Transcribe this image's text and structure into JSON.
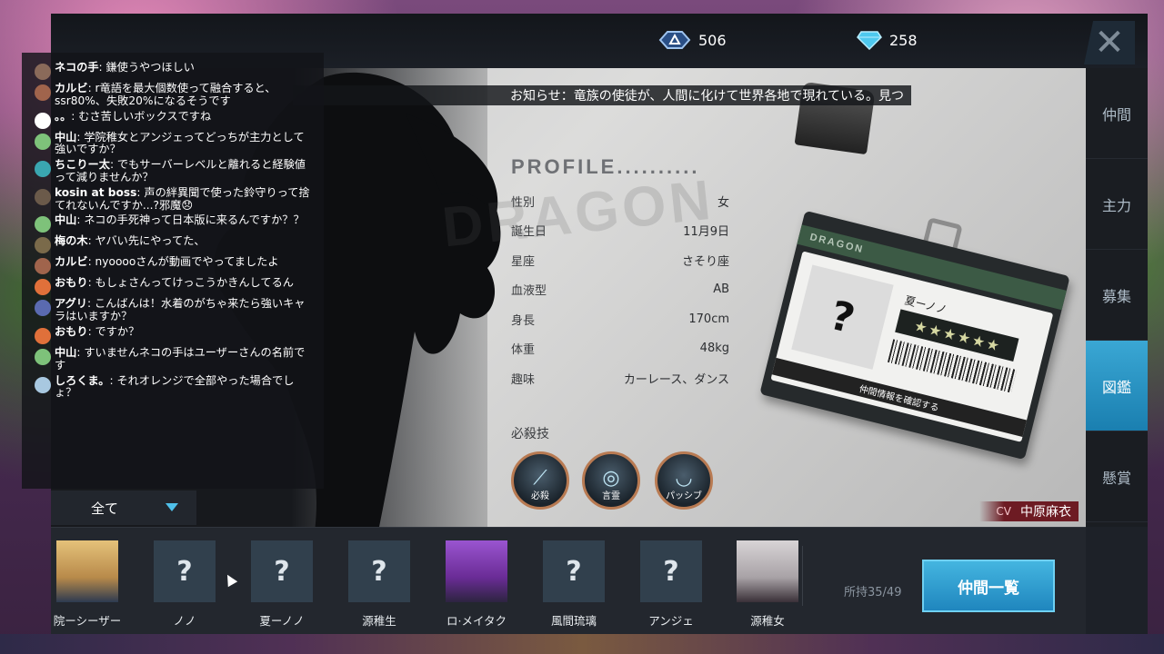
{
  "currency": {
    "tickets": "506",
    "gems": "258"
  },
  "notice": "お知らせ：竜族の使徒が、人間に化けて世界各地で現れている。見つ",
  "watermark": "DRAGON",
  "profile": {
    "title": "PROFILE..........",
    "rows": [
      {
        "label": "性別",
        "value": "女"
      },
      {
        "label": "誕生日",
        "value": "11月9日"
      },
      {
        "label": "星座",
        "value": "さそり座"
      },
      {
        "label": "血液型",
        "value": "AB"
      },
      {
        "label": "身長",
        "value": "170cm"
      },
      {
        "label": "体重",
        "value": "48kg"
      },
      {
        "label": "趣味",
        "value": "カーレース、ダンス"
      }
    ],
    "skills_label": "必殺技",
    "skills": [
      "必殺",
      "言霊",
      "パッシブ"
    ]
  },
  "card": {
    "band": "DRAGON",
    "photo": "?",
    "name": "夏ーノノ",
    "confirm": "仲間情報を確認する"
  },
  "cv": {
    "prefix": "CV",
    "name": "中原麻衣"
  },
  "tabs": [
    "仲間",
    "主力",
    "募集",
    "図鑑",
    "懸賞"
  ],
  "active_tab": "図鑑",
  "filter": {
    "value": "全て"
  },
  "characters": [
    {
      "name": "院ーシーザー",
      "portrait": "",
      "color": "#c99a55"
    },
    {
      "name": "ノノ",
      "portrait": "?",
      "color": ""
    },
    {
      "name": "夏ーノノ",
      "portrait": "?",
      "color": ""
    },
    {
      "name": "源稚生",
      "portrait": "?",
      "color": ""
    },
    {
      "name": "ロ·メイタク",
      "portrait": "",
      "color": "#7a3fb0"
    },
    {
      "name": "風間琉璃",
      "portrait": "?",
      "color": ""
    },
    {
      "name": "アンジェ",
      "portrait": "?",
      "color": ""
    },
    {
      "name": "源稚女",
      "portrait": "",
      "color": "#b8b3b5"
    }
  ],
  "owned": "所持35/49",
  "list_button": "仲間一覧",
  "chat": [
    {
      "name": "ネコの手",
      "text": "鎌使うやつほしい",
      "color": "#8a6a5a"
    },
    {
      "name": "カルビ",
      "text": "r竜語を最大個数使って融合すると、ssr80%、失敗20%になるそうです",
      "color": "#a0644c"
    },
    {
      "name": "。。",
      "text": "むさ苦しいボックスですね",
      "color": "#ffffff"
    },
    {
      "name": "中山",
      "text": "学院稚女とアンジェってどっちが主力として強いですか？",
      "color": "#7ec27a"
    },
    {
      "name": "ちこりー太",
      "text": "でもサーバーレベルと離れると経験値って減りませんか？",
      "color": "#3aa6b0"
    },
    {
      "name": "kosin at boss",
      "text": "声の絆異聞で使った鈴守りって捨てれないんですか...?邪魔😞",
      "color": "#6b5a4a"
    },
    {
      "name": "中山",
      "text": "ネコの手死神って日本版に来るんですか？？",
      "color": "#7ec27a"
    },
    {
      "name": "梅の木",
      "text": "ヤバい先にやってた、",
      "color": "#7a6a4a"
    },
    {
      "name": "カルビ",
      "text": "nyooooさんが動画でやってましたよ",
      "color": "#a0644c"
    },
    {
      "name": "おもり",
      "text": "もしょさんってけっこうかきんしてるん",
      "color": "#e0703a"
    },
    {
      "name": "アグリ",
      "text": "こんばんは！水着のがちゃ来たら強いキャラはいますか？",
      "color": "#5a6ab0"
    },
    {
      "name": "おもり",
      "text": "ですか？",
      "color": "#e0703a"
    },
    {
      "name": "中山",
      "text": "すいませんネコの手はユーザーさんの名前です",
      "color": "#7ec27a"
    },
    {
      "name": "しろくま。",
      "text": "それオレンジで全部やった場合でしょ？",
      "color": "#a8c8e0"
    }
  ]
}
